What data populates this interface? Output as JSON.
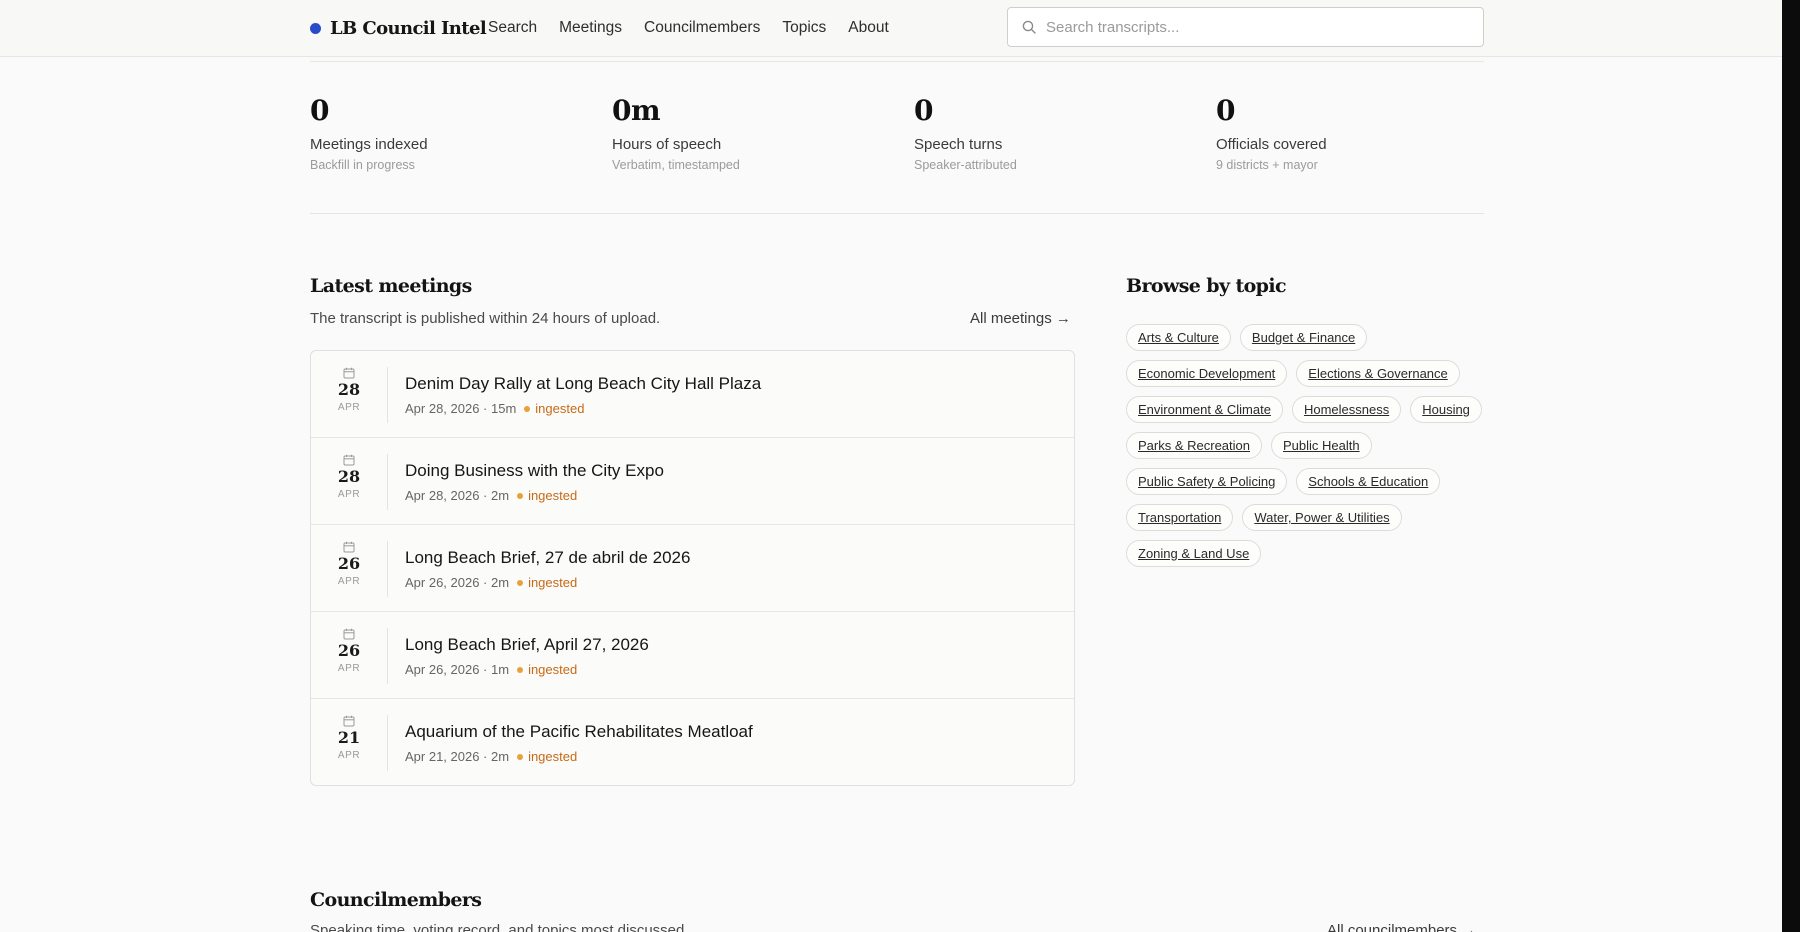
{
  "app": {
    "brand": "LB Council Intel",
    "accent_color": "#2a4bc9",
    "status_color": "#e8a13a",
    "status_text_color": "#c76a16"
  },
  "nav": {
    "items": [
      "Search",
      "Meetings",
      "Councilmembers",
      "Topics",
      "About"
    ]
  },
  "search": {
    "placeholder": "Search transcripts...",
    "icon": "search-icon"
  },
  "stats": [
    {
      "value": "0",
      "label": "Meetings indexed",
      "sub": "Backfill in progress"
    },
    {
      "value": "0m",
      "label": "Hours of speech",
      "sub": "Verbatim, timestamped"
    },
    {
      "value": "0",
      "label": "Speech turns",
      "sub": "Speaker-attributed"
    },
    {
      "value": "0",
      "label": "Officials covered",
      "sub": "9 districts + mayor"
    }
  ],
  "latest": {
    "title": "Latest meetings",
    "subtitle": "The transcript is published within 24 hours of upload.",
    "all_link": "All meetings →",
    "meetings": [
      {
        "day": "28",
        "month": "APR",
        "title": "Denim Day Rally at Long Beach City Hall Plaza",
        "meta": "Apr 28, 2026 · 15m",
        "status": "ingested"
      },
      {
        "day": "28",
        "month": "APR",
        "title": "Doing Business with the City Expo",
        "meta": "Apr 28, 2026 · 2m",
        "status": "ingested"
      },
      {
        "day": "26",
        "month": "APR",
        "title": "Long Beach Brief, 27 de abril de 2026",
        "meta": "Apr 26, 2026 · 2m",
        "status": "ingested"
      },
      {
        "day": "26",
        "month": "APR",
        "title": "Long Beach Brief, April 27, 2026",
        "meta": "Apr 26, 2026 · 1m",
        "status": "ingested"
      },
      {
        "day": "21",
        "month": "APR",
        "title": "Aquarium of the Pacific Rehabilitates Meatloaf",
        "meta": "Apr 21, 2026 · 2m",
        "status": "ingested"
      }
    ]
  },
  "topics": {
    "title": "Browse by topic",
    "items": [
      "Arts & Culture",
      "Budget & Finance",
      "Economic Development",
      "Elections & Governance",
      "Environment & Climate",
      "Homelessness",
      "Housing",
      "Parks & Recreation",
      "Public Health",
      "Public Safety & Policing",
      "Schools & Education",
      "Transportation",
      "Water, Power & Utilities",
      "Zoning & Land Use"
    ]
  },
  "council": {
    "title": "Councilmembers",
    "subtitle": "Speaking time, voting record, and topics most discussed.",
    "all_link": "All councilmembers →"
  }
}
